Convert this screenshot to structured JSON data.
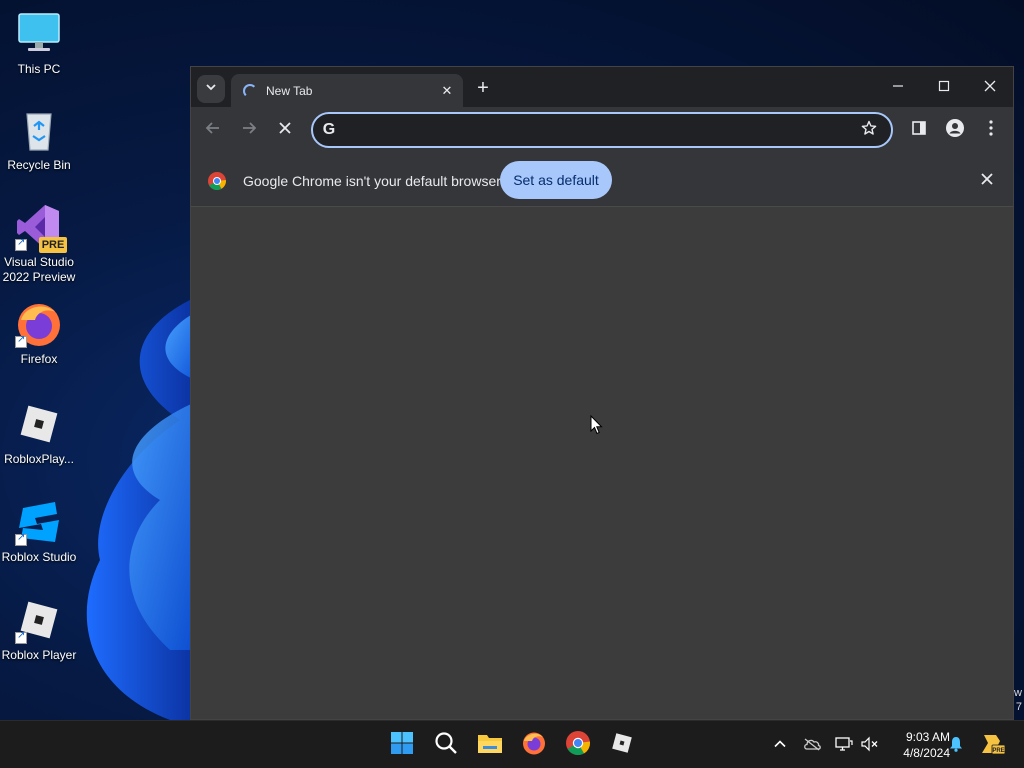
{
  "desktop": {
    "icons": [
      {
        "label": "This PC",
        "icon": "computer-icon"
      },
      {
        "label": "Recycle Bin",
        "icon": "recycle-bin-icon"
      },
      {
        "label": "Visual Studio 2022 Preview",
        "icon": "visual-studio-preview-icon",
        "badge": "PRE"
      },
      {
        "label": "Firefox",
        "icon": "firefox-icon"
      },
      {
        "label": "RobloxPlay...",
        "icon": "roblox-player-icon"
      },
      {
        "label": "Roblox Studio",
        "icon": "roblox-studio-icon"
      },
      {
        "label": "Roblox Player",
        "icon": "roblox-player-icon"
      }
    ],
    "edge_text": "w\n7"
  },
  "browser": {
    "tab": {
      "title": "New Tab",
      "loading": true
    },
    "omnibox": {
      "value": "",
      "placeholder": ""
    },
    "infobar": {
      "message": "Google Chrome isn't your default browser",
      "button_label": "Set as default"
    },
    "colors": {
      "accent": "#a8c7fa",
      "frame": "#202124",
      "toolbar": "#35363a",
      "content": "#3c3c3c"
    }
  },
  "taskbar": {
    "apps": [
      "windows-start-icon",
      "search-icon",
      "file-explorer-icon",
      "firefox-icon",
      "chrome-icon",
      "roblox-icon"
    ],
    "tray": [
      "chevron-up-icon",
      "onedrive-icon",
      "network-icon",
      "volume-muted-icon",
      "notification-bell-icon",
      "dev-badge-icon"
    ],
    "time": "9:03 AM",
    "date": "4/8/2024"
  }
}
